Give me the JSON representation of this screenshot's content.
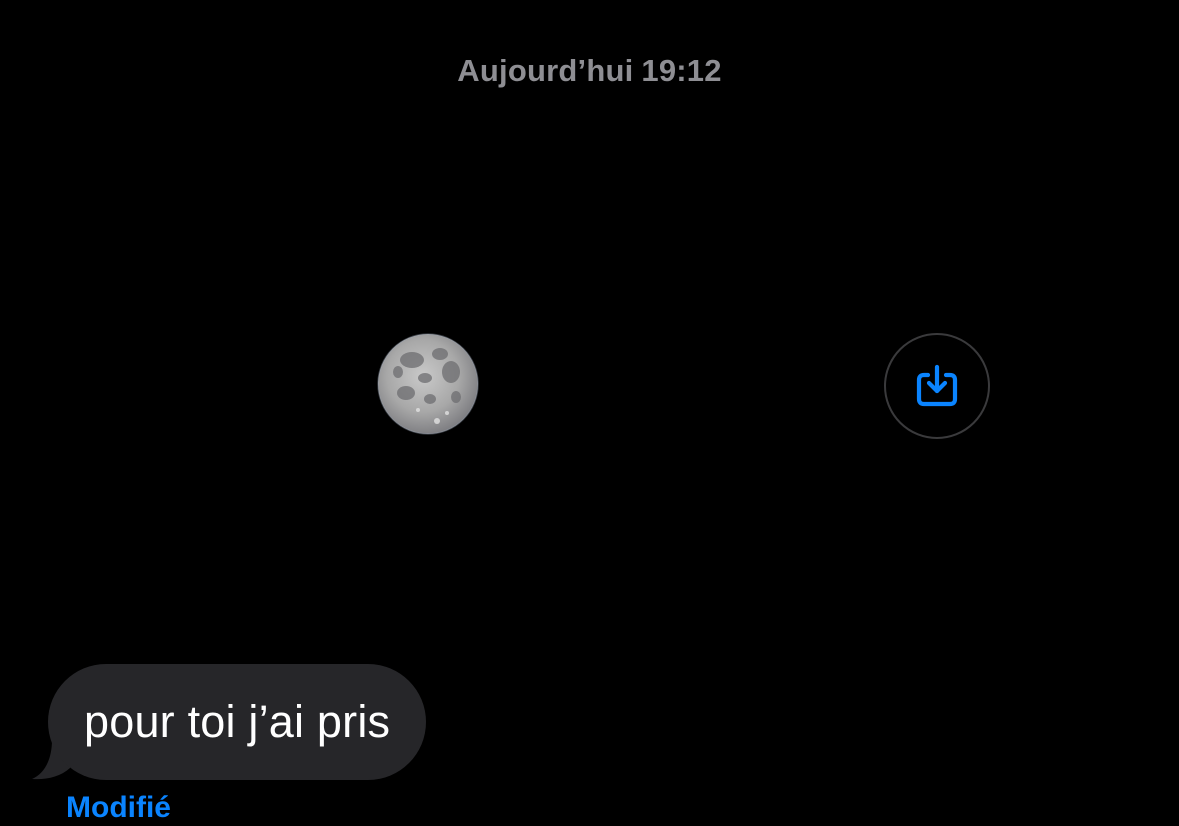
{
  "conversation": {
    "timestamp": {
      "day": "Aujourd’hui",
      "time": "19:12"
    },
    "photo_message": {
      "content_description_icon": "moon-photo",
      "save_button_icon": "save-download-icon"
    },
    "text_message": {
      "text": "pour toi j’ai pris",
      "status": "Modifié"
    }
  },
  "colors": {
    "background": "#000000",
    "timestamp": "#8e8e93",
    "bubble": "#262629",
    "accent": "#0a84ff"
  }
}
